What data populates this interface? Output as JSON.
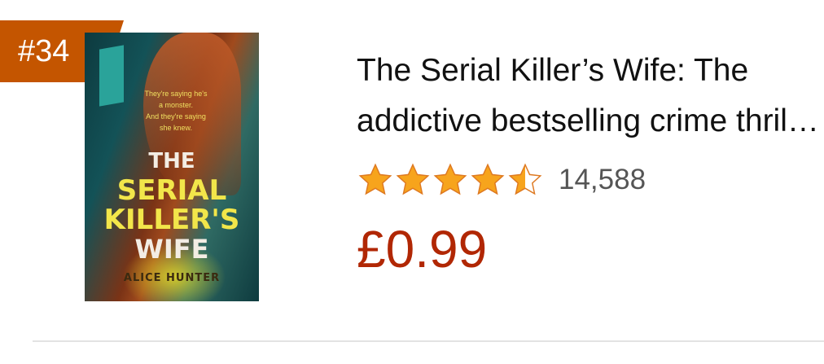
{
  "item": {
    "rank": "#34",
    "cover": {
      "tagline": "They're saying he's\na monster.\nAnd they're saying\nshe knew.",
      "title_lines": [
        "THE",
        "SERIAL",
        "KILLER'S",
        "WIFE"
      ],
      "author": "ALICE HUNTER"
    },
    "title": "The Serial Killer’s Wife: The addictive bestselling crime thriller of the year",
    "rating": {
      "stars": 4.5,
      "max": 5
    },
    "review_count": "14,588",
    "price": "£0.99"
  },
  "colors": {
    "badge": "#c45500",
    "price": "#b12704",
    "star": "#f7a41c",
    "star_outline": "#de7921"
  }
}
